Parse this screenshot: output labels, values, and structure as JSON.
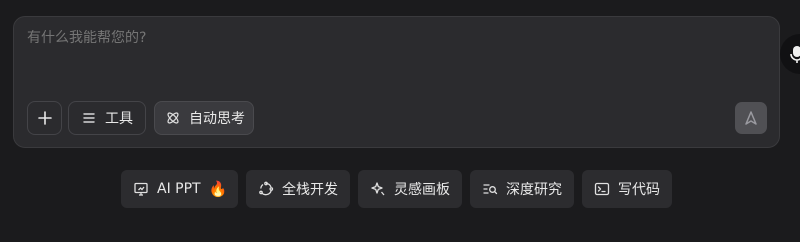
{
  "composer": {
    "placeholder": "有什么我能帮您的?",
    "add_button_icon": "plus-icon",
    "tools_label": "工具",
    "tools_icon": "list-icon",
    "think_label": "自动思考",
    "think_icon": "atom-icon",
    "send_icon": "send-arrow-icon",
    "mic_icon": "microphone-icon"
  },
  "suggestions": [
    {
      "label": "AI PPT",
      "icon": "slides-icon",
      "badge": "🔥"
    },
    {
      "label": "全栈开发",
      "icon": "cycle-icon"
    },
    {
      "label": "灵感画板",
      "icon": "sparkle-icon"
    },
    {
      "label": "深度研究",
      "icon": "research-icon"
    },
    {
      "label": "写代码",
      "icon": "terminal-icon"
    }
  ]
}
